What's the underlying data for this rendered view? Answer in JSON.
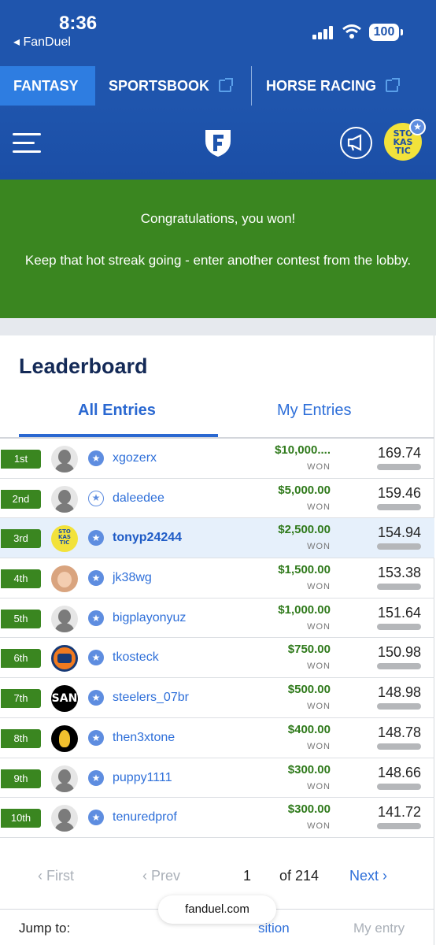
{
  "status": {
    "time": "8:36",
    "back_app": "◂ FanDuel",
    "battery": "100"
  },
  "nav": {
    "tabs": [
      "FANTASY",
      "SPORTSBOOK",
      "HORSE RACING"
    ]
  },
  "header": {
    "avatar_text": "STO KAS TIC"
  },
  "banner": {
    "line1": "Congratulations, you won!",
    "line2": "Keep that hot streak going - enter another contest from the lobby."
  },
  "leaderboard": {
    "title": "Leaderboard",
    "tab_all": "All Entries",
    "tab_my": "My Entries",
    "won_label": "WON",
    "rows": [
      {
        "rank": "1st",
        "user": "xgozerx",
        "prize": "$10,000....",
        "score": "169.74",
        "avatar": "default"
      },
      {
        "rank": "2nd",
        "user": "daleedee",
        "prize": "$5,000.00",
        "score": "159.46",
        "avatar": "default"
      },
      {
        "rank": "3rd",
        "user": "tonyp24244",
        "prize": "$2,500.00",
        "score": "154.94",
        "avatar": "stokastic"
      },
      {
        "rank": "4th",
        "user": "jk38wg",
        "prize": "$1,500.00",
        "score": "153.38",
        "avatar": "photo"
      },
      {
        "rank": "5th",
        "user": "bigplayonyuz",
        "prize": "$1,000.00",
        "score": "151.64",
        "avatar": "default"
      },
      {
        "rank": "6th",
        "user": "tkosteck",
        "prize": "$750.00",
        "score": "150.98",
        "avatar": "tigers-logo"
      },
      {
        "rank": "7th",
        "user": "steelers_07br",
        "prize": "$500.00",
        "score": "148.98",
        "avatar": "san-logo"
      },
      {
        "rank": "8th",
        "user": "then3xtone",
        "prize": "$400.00",
        "score": "148.78",
        "avatar": "penguins-logo"
      },
      {
        "rank": "9th",
        "user": "puppy1111",
        "prize": "$300.00",
        "score": "148.66",
        "avatar": "default"
      },
      {
        "rank": "10th",
        "user": "tenuredprof",
        "prize": "$300.00",
        "score": "141.72",
        "avatar": "default"
      }
    ]
  },
  "pager": {
    "first": "First",
    "prev": "Prev",
    "page": "1",
    "of": "of 214",
    "next": "Next"
  },
  "jump": {
    "label": "Jump to:",
    "position": "sition",
    "my_entry": "My entry"
  },
  "browser": {
    "url": "fanduel.com"
  },
  "colors": {
    "brand_blue": "#1f55ad",
    "win_green": "#3a8620",
    "link_blue": "#2e6fd9"
  }
}
